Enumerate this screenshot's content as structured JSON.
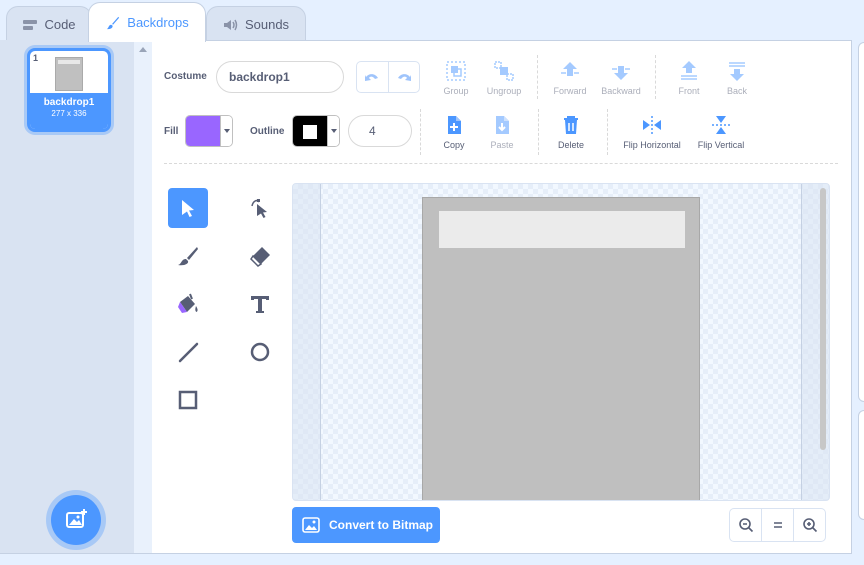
{
  "tabs": [
    {
      "label": "Code",
      "icon": "code-blocks-icon"
    },
    {
      "label": "Backdrops",
      "icon": "paintbrush-icon",
      "active": true
    },
    {
      "label": "Sounds",
      "icon": "speaker-icon"
    }
  ],
  "selector": {
    "items": [
      {
        "number": "1",
        "name": "backdrop1",
        "size": "277 x 336",
        "selected": true
      }
    ],
    "add_icon": "add-backdrop-icon"
  },
  "editor": {
    "costume_label": "Costume",
    "costume_name": "backdrop1",
    "fill_label": "Fill",
    "outline_label": "Outline",
    "outline_width": "4",
    "group_label": "Group",
    "ungroup_label": "Ungroup",
    "forward_label": "Forward",
    "backward_label": "Backward",
    "front_label": "Front",
    "back_label": "Back",
    "copy_label": "Copy",
    "paste_label": "Paste",
    "delete_label": "Delete",
    "flip_h_label": "Flip Horizontal",
    "flip_v_label": "Flip Vertical",
    "convert_label": "Convert to Bitmap"
  },
  "colors": {
    "accent": "#4c97ff",
    "fill": "#9966ff",
    "outline": "#000000",
    "backdrop": "#bfbfbf"
  }
}
